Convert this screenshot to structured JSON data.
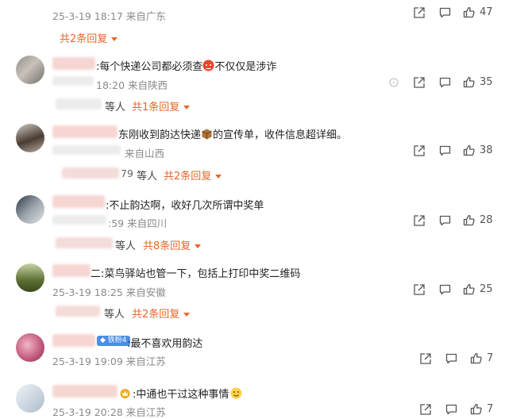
{
  "top": {
    "time": "25-3-19 18:17 来自广东",
    "likes": "47",
    "reply_label": "共2条回复"
  },
  "comments": [
    {
      "text_prefix": ":每个快递公司都必须查",
      "text_suffix": "不仅仅是涉诈",
      "meta": "18:20 来自陕西",
      "likes": "35",
      "dengren": "等人",
      "reply_label": "共1条回复"
    },
    {
      "text": "东刚收到韵达快递",
      "text_suffix": "的宣传单，收件信息超详细。",
      "meta": "来自山西",
      "likes": "38",
      "partial": "79",
      "dengren": "等人",
      "reply_label": "共2条回复"
    },
    {
      "text": ":不止韵达啊，收好几次所谓中奖单",
      "meta": ":59 来自四川",
      "likes": "28",
      "partial": "",
      "dengren": "等人",
      "reply_label": "共8条回复"
    },
    {
      "text": "二:菜鸟驿站也管一下，包括上打印中奖二维码",
      "meta": "25-3-19 18:25 来自安徽",
      "likes": "25",
      "dengren": "等人",
      "reply_label": "共2条回复"
    },
    {
      "text": ":最不喜欢用韵达",
      "badge": "铁粉4",
      "meta": "25-3-19 19:09 来自江苏",
      "likes": "7"
    },
    {
      "text": ":中通也干过这种事情",
      "meta": "25-3-19 20:28 来自江苏",
      "likes": "7"
    }
  ],
  "icons": {
    "share": "share-icon",
    "comment": "comment-icon",
    "like": "thumbs-up-icon"
  },
  "colors": {
    "accent": "#e8672a",
    "meta_text": "#8a8a8a",
    "badge": "#4a8fe7"
  }
}
